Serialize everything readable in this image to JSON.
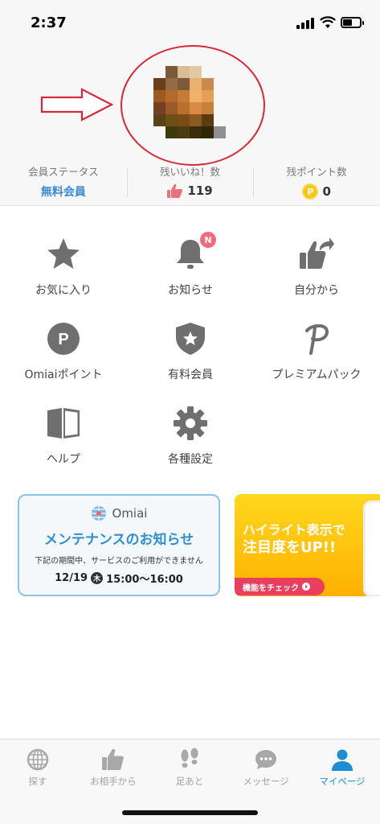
{
  "status_bar": {
    "time": "2:37"
  },
  "stats": [
    {
      "label": "会員ステータス",
      "value": "無料会員"
    },
    {
      "label": "残いいね！数",
      "value": "119"
    },
    {
      "label": "残ポイント数",
      "value": "0"
    }
  ],
  "menu": {
    "items": [
      {
        "label": "お気に入り",
        "icon": "star-icon"
      },
      {
        "label": "お知らせ",
        "icon": "bell-icon",
        "badge": "N"
      },
      {
        "label": "自分から",
        "icon": "thumbs-up-share-icon"
      },
      {
        "label": "Omiaiポイント",
        "icon": "point-p-icon"
      },
      {
        "label": "有料会員",
        "icon": "shield-star-icon"
      },
      {
        "label": "プレミアムパック",
        "icon": "script-p-icon"
      },
      {
        "label": "ヘルプ",
        "icon": "book-icon"
      },
      {
        "label": "各種設定",
        "icon": "gear-icon"
      }
    ]
  },
  "banners": {
    "maintenance": {
      "logo": "Omiai",
      "title": "メンテナンスのお知らせ",
      "description": "下記の期間中、サービスのご利用ができません",
      "date": "12/19",
      "day": "木",
      "time": "15:00〜16:00"
    },
    "highlight": {
      "title_line1": "ハイライト表示で",
      "title_line2": "注目度をUP!!",
      "button": "機能をチェック"
    }
  },
  "tabs": [
    {
      "label": "探す",
      "icon": "globe-icon",
      "active": false
    },
    {
      "label": "お相手から",
      "icon": "thumbs-up-icon",
      "active": false
    },
    {
      "label": "足あと",
      "icon": "footprints-icon",
      "active": false
    },
    {
      "label": "メッセージ",
      "icon": "chat-bubble-icon",
      "active": false
    },
    {
      "label": "マイページ",
      "icon": "person-icon",
      "active": true
    }
  ],
  "colors": {
    "accent_blue": "#1c8fd3",
    "annotation_red": "#d62b36",
    "icon_gray": "#6f6f6f",
    "badge_pink": "#f26b7a",
    "highlight_yellow": "#ffc800"
  }
}
